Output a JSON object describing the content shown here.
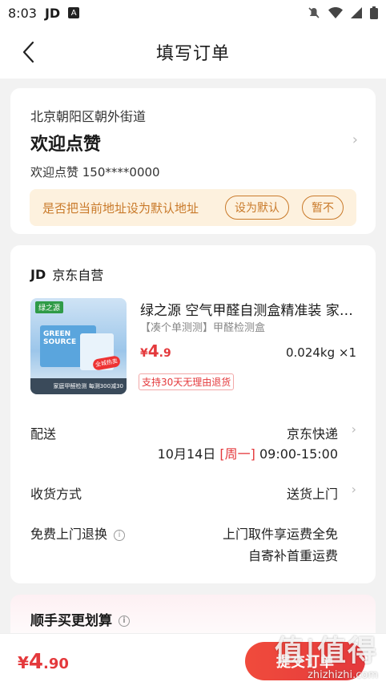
{
  "status_bar": {
    "time": "8:03",
    "app_badge": "JD",
    "a_badge": "A"
  },
  "header": {
    "title": "填写订单",
    "back_icon": "chevron-left-icon"
  },
  "address": {
    "region": "北京朝阳区朝外街道",
    "name": "欢迎点赞",
    "contact": "欢迎点赞  150****0000",
    "banner_text": "是否把当前地址设为默认地址",
    "set_default_label": "设为默认",
    "not_now_label": "暂不"
  },
  "order": {
    "store_logo": "JD",
    "store_name": "京东自营",
    "product": {
      "brand_tag": "绿之源",
      "box_text": "GREEN SOURCE",
      "badge": "全城热卖",
      "image_footer": "家庭甲醛检测 每测300减30",
      "title": "绿之源 空气甲醛自测盒精准装 家居甲醛检测",
      "spec": "【凑个单测测】甲醛检测盒",
      "price_currency": "¥",
      "price_int": "4",
      "price_dec": ".9",
      "quantity": "0.024kg ×1",
      "return_policy": "支持30天无理由退货"
    },
    "delivery": {
      "label": "配送",
      "carrier": "京东快递",
      "date": "10月14日",
      "weekday": "[周一]",
      "time_window": "09:00-15:00"
    },
    "receive": {
      "label": "收货方式",
      "value": "送货上门"
    },
    "return_service": {
      "label": "免费上门退换",
      "line1": "上门取件享运费全免",
      "line2": "自寄补首重运费"
    }
  },
  "promo": {
    "title": "顺手买更划算"
  },
  "footer": {
    "total_currency": "¥",
    "total_int": "4",
    "total_dec": ".90",
    "submit_label": "提交订单",
    "watermark_main": "值|值得",
    "watermark_sub": "zhizhizhi.com"
  },
  "colors": {
    "accent": "#e4393c",
    "banner_bg": "#fdf1de",
    "banner_text": "#c97a2a"
  }
}
